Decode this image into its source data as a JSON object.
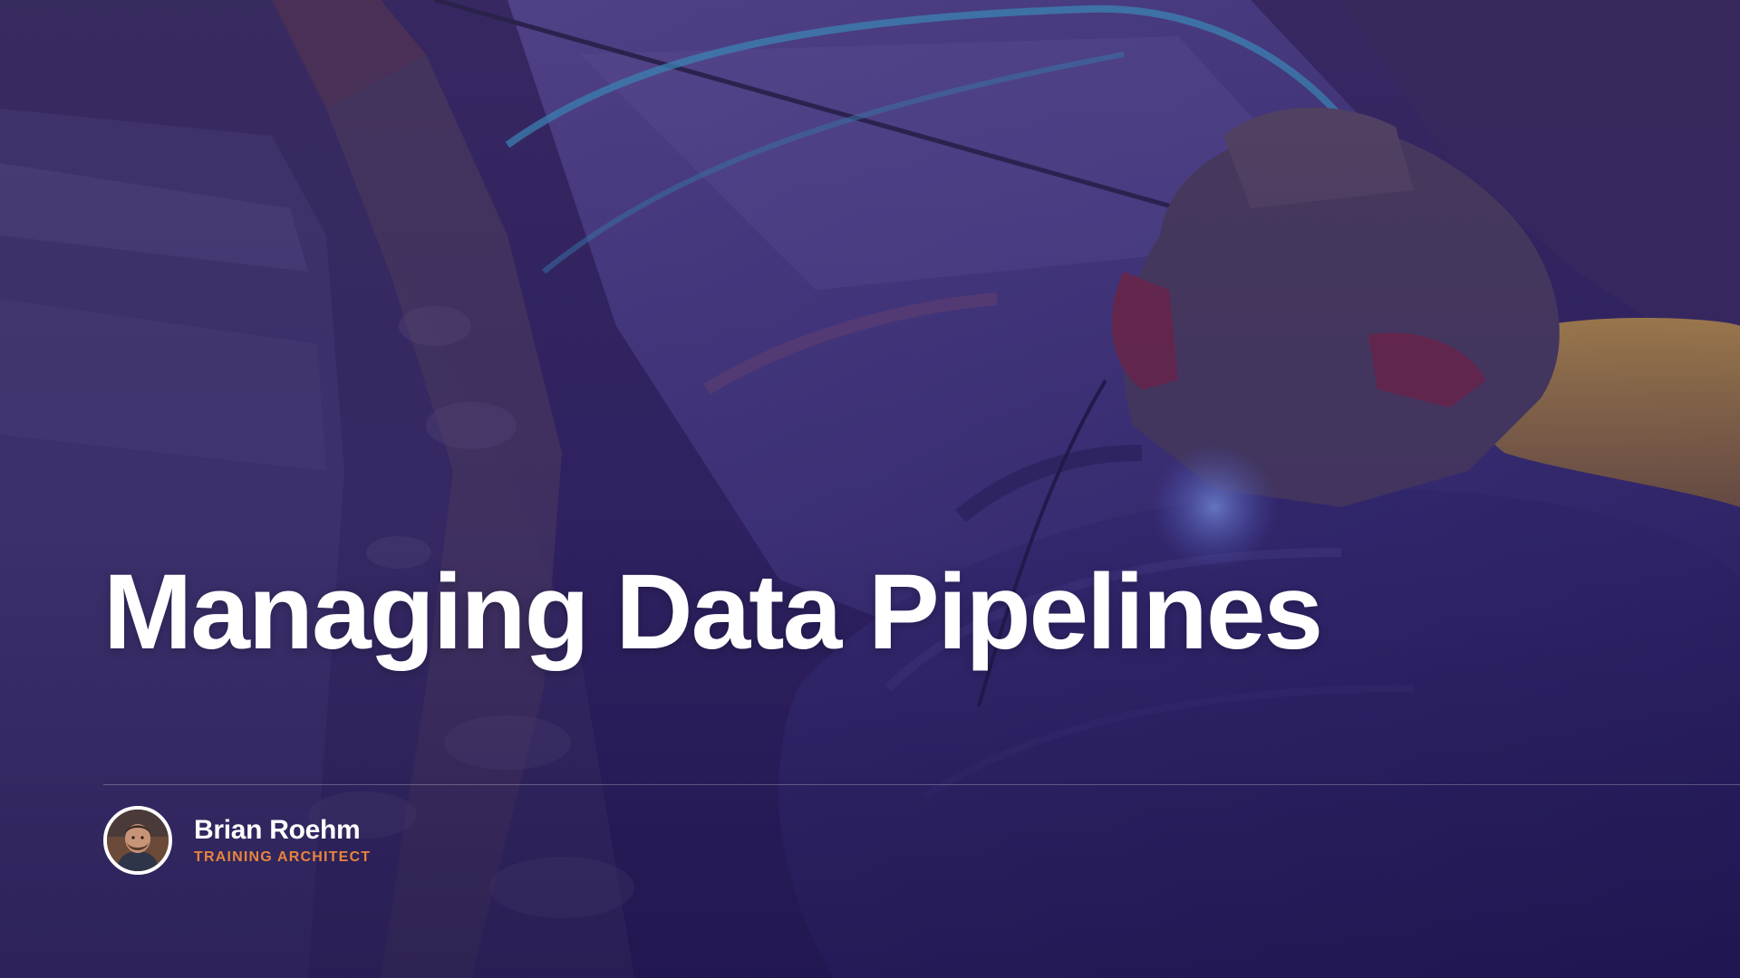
{
  "slide": {
    "title": "Managing Data Pipelines",
    "background_image": "pipeline-welding-photo",
    "overlay_color": "#2c1e6e"
  },
  "presenter": {
    "name": "Brian Roehm",
    "role": "TRAINING ARCHITECT",
    "role_color": "#e8843c",
    "avatar_icon": "presenter-avatar-photo"
  },
  "colors": {
    "title": "#ffffff",
    "background": "#1d1642",
    "accent_orange": "#e8843c"
  }
}
